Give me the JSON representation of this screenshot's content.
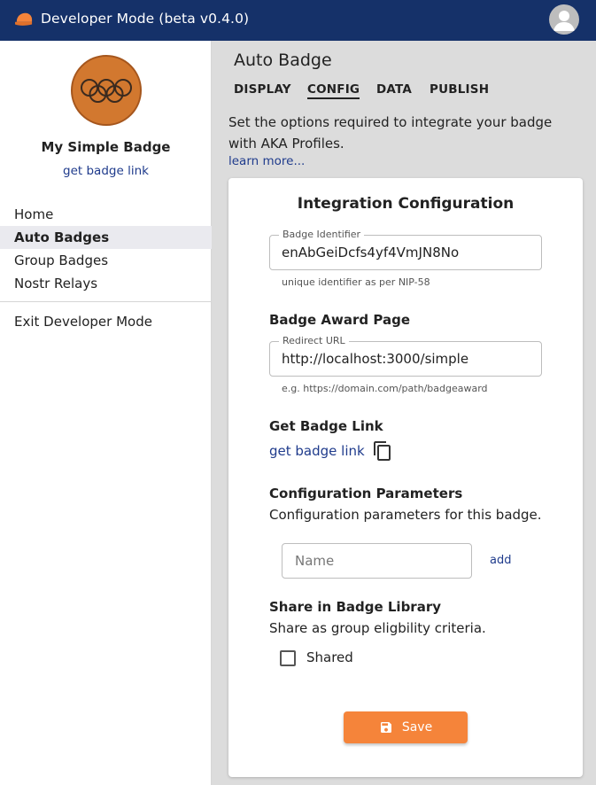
{
  "app": {
    "title": "Developer Mode (beta v0.4.0)",
    "logo_icon": "cap-icon",
    "avatar_icon": "account-icon",
    "accent_color": "#153169"
  },
  "sidebar": {
    "badge_name": "My Simple Badge",
    "badge_link": "get badge link",
    "items": [
      {
        "label": "Home"
      },
      {
        "label": "Auto Badges",
        "active": true
      },
      {
        "label": "Group Badges"
      },
      {
        "label": "Nostr Relays"
      }
    ],
    "exit_label": "Exit Developer Mode"
  },
  "main": {
    "title": "Auto Badge",
    "tabs": [
      {
        "label": "DISPLAY"
      },
      {
        "label": "CONFIG",
        "active": true
      },
      {
        "label": "DATA"
      },
      {
        "label": "PUBLISH"
      }
    ],
    "description": "Set the options required to integrate your badge with AKA Profiles.",
    "learn_more": "learn more..."
  },
  "card": {
    "title": "Integration Configuration",
    "badge_identifier": {
      "label": "Badge Identifier",
      "value": "enAbGeiDcfs4yf4VmJN8No",
      "helper": "unique identifier as per NIP-58"
    },
    "award_page": {
      "title": "Badge Award Page",
      "label": "Redirect URL",
      "value": "http://localhost:3000/simple",
      "helper": "e.g. https://domain.com/path/badgeaward"
    },
    "get_link": {
      "title": "Get Badge Link",
      "link": "get badge link",
      "icon": "copy-icon"
    },
    "params": {
      "title": "Configuration Parameters",
      "description": "Configuration parameters for this badge.",
      "name_placeholder": "Name",
      "add_label": "add"
    },
    "library": {
      "title": "Share in Badge Library",
      "description": "Share as group eligbility criteria.",
      "checkbox_label": "Shared",
      "checked": false
    },
    "save_label": "Save",
    "save_color": "#f5843a"
  }
}
